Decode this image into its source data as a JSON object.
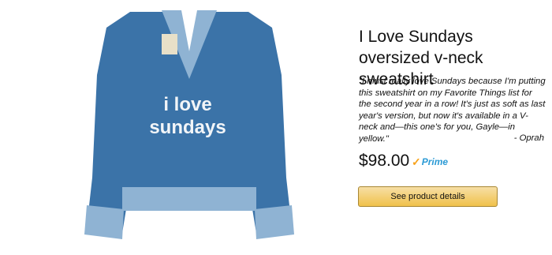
{
  "product": {
    "title": "I Love Sundays oversized v-neck sweatshirt",
    "shirt_text_line1": "i love",
    "shirt_text_line2": "sundays",
    "quote": "\"I must really love Sundays because I'm putting this sweatshirt on my Favorite Things list for the second year in a row! It's just as soft as last year's version, but now it's available in a V-neck and—this one's for you, Gayle—in yellow.\"",
    "attribution": "- Oprah",
    "price": "$98.00",
    "prime_label": "Prime",
    "cta_label": "See product details",
    "colors": {
      "shirt": "#3b73a8",
      "trim": "#8fb3d3",
      "button": "#f0c14b",
      "prime": "#2b9ad5"
    }
  }
}
